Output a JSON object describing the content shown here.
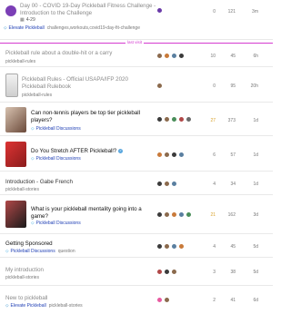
{
  "last_visit_label": "last visit",
  "topics": [
    {
      "title": "Day 00 - COVID 19-Day Pickleball Fitness Challenge - Introduction to the Challenge",
      "date": "4-29",
      "category": "Elevate Pickleball",
      "tags": "challenges,workouts,covid19-day-fit-challenge",
      "replies": "0",
      "views": "121",
      "activity": "3m"
    },
    {
      "title": "Pickleball rule about a double-hit or a carry",
      "category": "",
      "tags": "pickleball-rules",
      "replies": "10",
      "views": "45",
      "activity": "6h"
    },
    {
      "title": "Pickleball Rules - Official USAPA/IFP 2020 Pickleball Rulebook",
      "category": "",
      "tags": "pickleball-rules",
      "replies": "0",
      "views": "95",
      "activity": "20h"
    },
    {
      "title": "Can non-tennis players be top tier pickleball players?",
      "category": "Pickleball Discussions",
      "tags": "",
      "replies": "27",
      "views": "373",
      "activity": "1d"
    },
    {
      "title": "Do You Stretch AFTER Pickleball?",
      "category": "Pickleball Discussions",
      "tags": "",
      "replies": "6",
      "views": "57",
      "activity": "1d"
    },
    {
      "title": "Introduction - Gabe French",
      "category": "",
      "tags": "pickleball-stories",
      "replies": "4",
      "views": "34",
      "activity": "1d"
    },
    {
      "title": "What is your pickleball mentality going into a game?",
      "category": "Pickleball Discussions",
      "tags": "",
      "replies": "21",
      "views": "162",
      "activity": "3d"
    },
    {
      "title": "Getting Sponsored",
      "category": "Pickleball Discussions",
      "tags": "question",
      "replies": "4",
      "views": "45",
      "activity": "5d"
    },
    {
      "title": "My introduction",
      "category": "",
      "tags": "pickleball-stories",
      "replies": "3",
      "views": "38",
      "activity": "5d"
    },
    {
      "title": "New to pickleball",
      "category": "Elevate Pickleball",
      "tags": "pickleball-stories",
      "replies": "2",
      "views": "41",
      "activity": "6d"
    }
  ],
  "colors": {
    "accent_link": "#1f3fb5",
    "last_visit_line": "#d43bd0",
    "unread_dot": "#2c62d8",
    "hot_count": "#d9a22c",
    "category_elevate": "#1f87c8",
    "category_discussions": "#2aa3e0"
  },
  "icons": {
    "calendar": "calendar-icon",
    "tag": "tag-icon",
    "verified": "check-badge-icon"
  }
}
